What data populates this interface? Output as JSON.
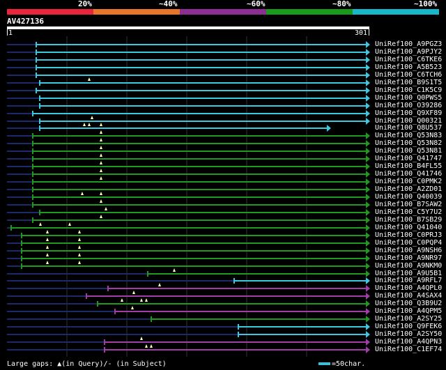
{
  "legend": {
    "labels": [
      "20%",
      "~40%",
      "~60%",
      "~80%",
      "~100%"
    ],
    "colors": [
      "#e8253a",
      "#e8762a",
      "#8c2e94",
      "#1a9a1a",
      "#18b8c8"
    ]
  },
  "query": {
    "title": "AV427136",
    "start": "1",
    "end": "301"
  },
  "footer": {
    "gaps_text": "Large gaps: ▲(in Query)/- (in Subject)",
    "scale_text": "=50char."
  },
  "colors": {
    "cyan": "#3cc8e0",
    "green": "#1e9a1e",
    "magenta": "#a23ca8",
    "navy": "#1a2a6a"
  },
  "hits": [
    {
      "id": "UniRef100_A9PGZ3",
      "color": "cyan",
      "start": 52,
      "end": 525,
      "gaps": []
    },
    {
      "id": "UniRef100_A9PJY2",
      "color": "cyan",
      "start": 52,
      "end": 525,
      "gaps": []
    },
    {
      "id": "UniRef100_C6TKE6",
      "color": "cyan",
      "start": 52,
      "end": 525,
      "gaps": []
    },
    {
      "id": "UniRef100_A5B523",
      "color": "cyan",
      "start": 52,
      "end": 525,
      "gaps": []
    },
    {
      "id": "UniRef100_C6TCH6",
      "color": "cyan",
      "start": 52,
      "end": 525,
      "gaps": []
    },
    {
      "id": "UniRef100_B9S1T5",
      "color": "cyan",
      "start": 57,
      "end": 525,
      "gaps": [
        128
      ]
    },
    {
      "id": "UniRef100_C1K5C9",
      "color": "cyan",
      "start": 52,
      "end": 525,
      "gaps": []
    },
    {
      "id": "UniRef100_Q0PWS5",
      "color": "cyan",
      "start": 57,
      "end": 525,
      "gaps": []
    },
    {
      "id": "UniRef100_O39286",
      "color": "cyan",
      "start": 57,
      "end": 525,
      "gaps": []
    },
    {
      "id": "UniRef100_Q9XF89",
      "color": "cyan",
      "start": 47,
      "end": 525,
      "gaps": []
    },
    {
      "id": "UniRef100_Q00321",
      "color": "cyan",
      "start": 57,
      "end": 525,
      "gaps": [
        132
      ]
    },
    {
      "id": "UniRef100_Q8U537",
      "color": "cyan",
      "start": 57,
      "end": 469,
      "gaps": [
        121,
        128,
        145
      ]
    },
    {
      "id": "UniRef100_Q53N83",
      "color": "green",
      "start": 47,
      "end": 525,
      "gaps": [
        145
      ]
    },
    {
      "id": "UniRef100_Q53N82",
      "color": "green",
      "start": 47,
      "end": 525,
      "gaps": [
        145
      ]
    },
    {
      "id": "UniRef100_Q53N81",
      "color": "green",
      "start": 47,
      "end": 525,
      "gaps": [
        145
      ]
    },
    {
      "id": "UniRef100_Q41747",
      "color": "green",
      "start": 47,
      "end": 525,
      "gaps": [
        145
      ]
    },
    {
      "id": "UniRef100_B4FL55",
      "color": "green",
      "start": 47,
      "end": 525,
      "gaps": [
        145
      ]
    },
    {
      "id": "UniRef100_Q41746",
      "color": "green",
      "start": 47,
      "end": 525,
      "gaps": [
        145
      ]
    },
    {
      "id": "UniRef100_C0PMK2",
      "color": "green",
      "start": 47,
      "end": 525,
      "gaps": [
        145
      ]
    },
    {
      "id": "UniRef100_A2ZD01",
      "color": "green",
      "start": 47,
      "end": 525,
      "gaps": []
    },
    {
      "id": "UniRef100_Q40039",
      "color": "green",
      "start": 47,
      "end": 525,
      "gaps": [
        118,
        145
      ]
    },
    {
      "id": "UniRef100_B7SAW2",
      "color": "green",
      "start": 47,
      "end": 525,
      "gaps": [
        145
      ]
    },
    {
      "id": "UniRef100_C5Y7U2",
      "color": "green",
      "start": 57,
      "end": 525,
      "gaps": [
        152
      ]
    },
    {
      "id": "UniRef100_B7SB29",
      "color": "green",
      "start": 47,
      "end": 525,
      "gaps": [
        145
      ]
    },
    {
      "id": "UniRef100_Q41040",
      "color": "green",
      "start": 16,
      "end": 525,
      "gaps": [
        58,
        100
      ]
    },
    {
      "id": "UniRef100_C0PRJ3",
      "color": "green",
      "start": 31,
      "end": 525,
      "gaps": [
        68,
        114
      ]
    },
    {
      "id": "UniRef100_C0PQP4",
      "color": "green",
      "start": 31,
      "end": 525,
      "gaps": [
        68,
        114
      ]
    },
    {
      "id": "UniRef100_A9NSH6",
      "color": "green",
      "start": 31,
      "end": 525,
      "gaps": [
        68,
        114
      ]
    },
    {
      "id": "UniRef100_A9NR97",
      "color": "green",
      "start": 31,
      "end": 525,
      "gaps": [
        68,
        114
      ]
    },
    {
      "id": "UniRef100_A9NKM0",
      "color": "green",
      "start": 31,
      "end": 525,
      "gaps": [
        68,
        114
      ]
    },
    {
      "id": "UniRef100_A9U5B1",
      "color": "green",
      "start": 212,
      "end": 525,
      "gaps": [
        250
      ]
    },
    {
      "id": "UniRef100_A9RFL7",
      "color": "cyan",
      "start": 336,
      "end": 525,
      "gaps": []
    },
    {
      "id": "UniRef100_A4QPL0",
      "color": "magenta",
      "start": 155,
      "end": 525,
      "gaps": [
        229
      ]
    },
    {
      "id": "UniRef100_A4SAX4",
      "color": "magenta",
      "start": 124,
      "end": 525,
      "gaps": [
        192
      ]
    },
    {
      "id": "UniRef100_Q3B9U2",
      "color": "green",
      "start": 140,
      "end": 525,
      "gaps": [
        175,
        203,
        210
      ]
    },
    {
      "id": "UniRef100_A4QPM5",
      "color": "magenta",
      "start": 165,
      "end": 525,
      "gaps": [
        190
      ]
    },
    {
      "id": "UniRef100_A2SY25",
      "color": "green",
      "start": 217,
      "end": 525,
      "gaps": []
    },
    {
      "id": "UniRef100_Q9FEK6",
      "color": "cyan",
      "start": 342,
      "end": 525,
      "gaps": []
    },
    {
      "id": "UniRef100_A2SY50",
      "color": "cyan",
      "start": 342,
      "end": 525,
      "gaps": []
    },
    {
      "id": "UniRef100_A4QPN3",
      "color": "magenta",
      "start": 150,
      "end": 525,
      "gaps": [
        203
      ]
    },
    {
      "id": "UniRef100_C1EF74",
      "color": "magenta",
      "start": 150,
      "end": 525,
      "gaps": [
        210,
        217
      ]
    }
  ]
}
